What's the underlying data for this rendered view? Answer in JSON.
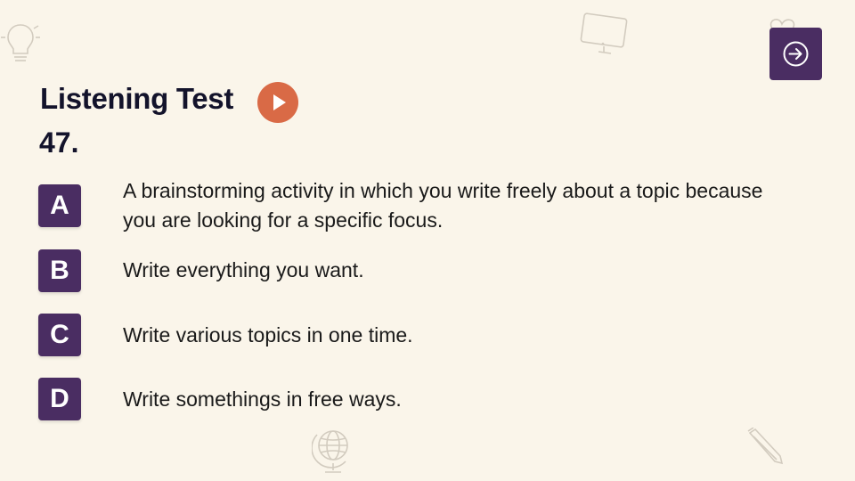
{
  "slide": {
    "title": "Listening Test",
    "question_number": "47."
  },
  "controls": {
    "play_icon": "play-icon",
    "next_icon": "arrow-right-circle-icon"
  },
  "options": [
    {
      "letter": "A",
      "text": "A brainstorming activity in which you write freely about a topic because you are looking for a specific focus."
    },
    {
      "letter": "B",
      "text": "Write everything you want."
    },
    {
      "letter": "C",
      "text": "Write various topics in one time."
    },
    {
      "letter": "D",
      "text": "Write somethings in free ways."
    }
  ],
  "decorations": [
    "lightbulb-icon",
    "monitor-icon",
    "heart-icon",
    "globe-icon",
    "pencil-icon"
  ],
  "colors": {
    "background": "#faf5ea",
    "accent_purple": "#4a2d62",
    "play_orange": "#d96a46",
    "title_text": "#13132b"
  }
}
